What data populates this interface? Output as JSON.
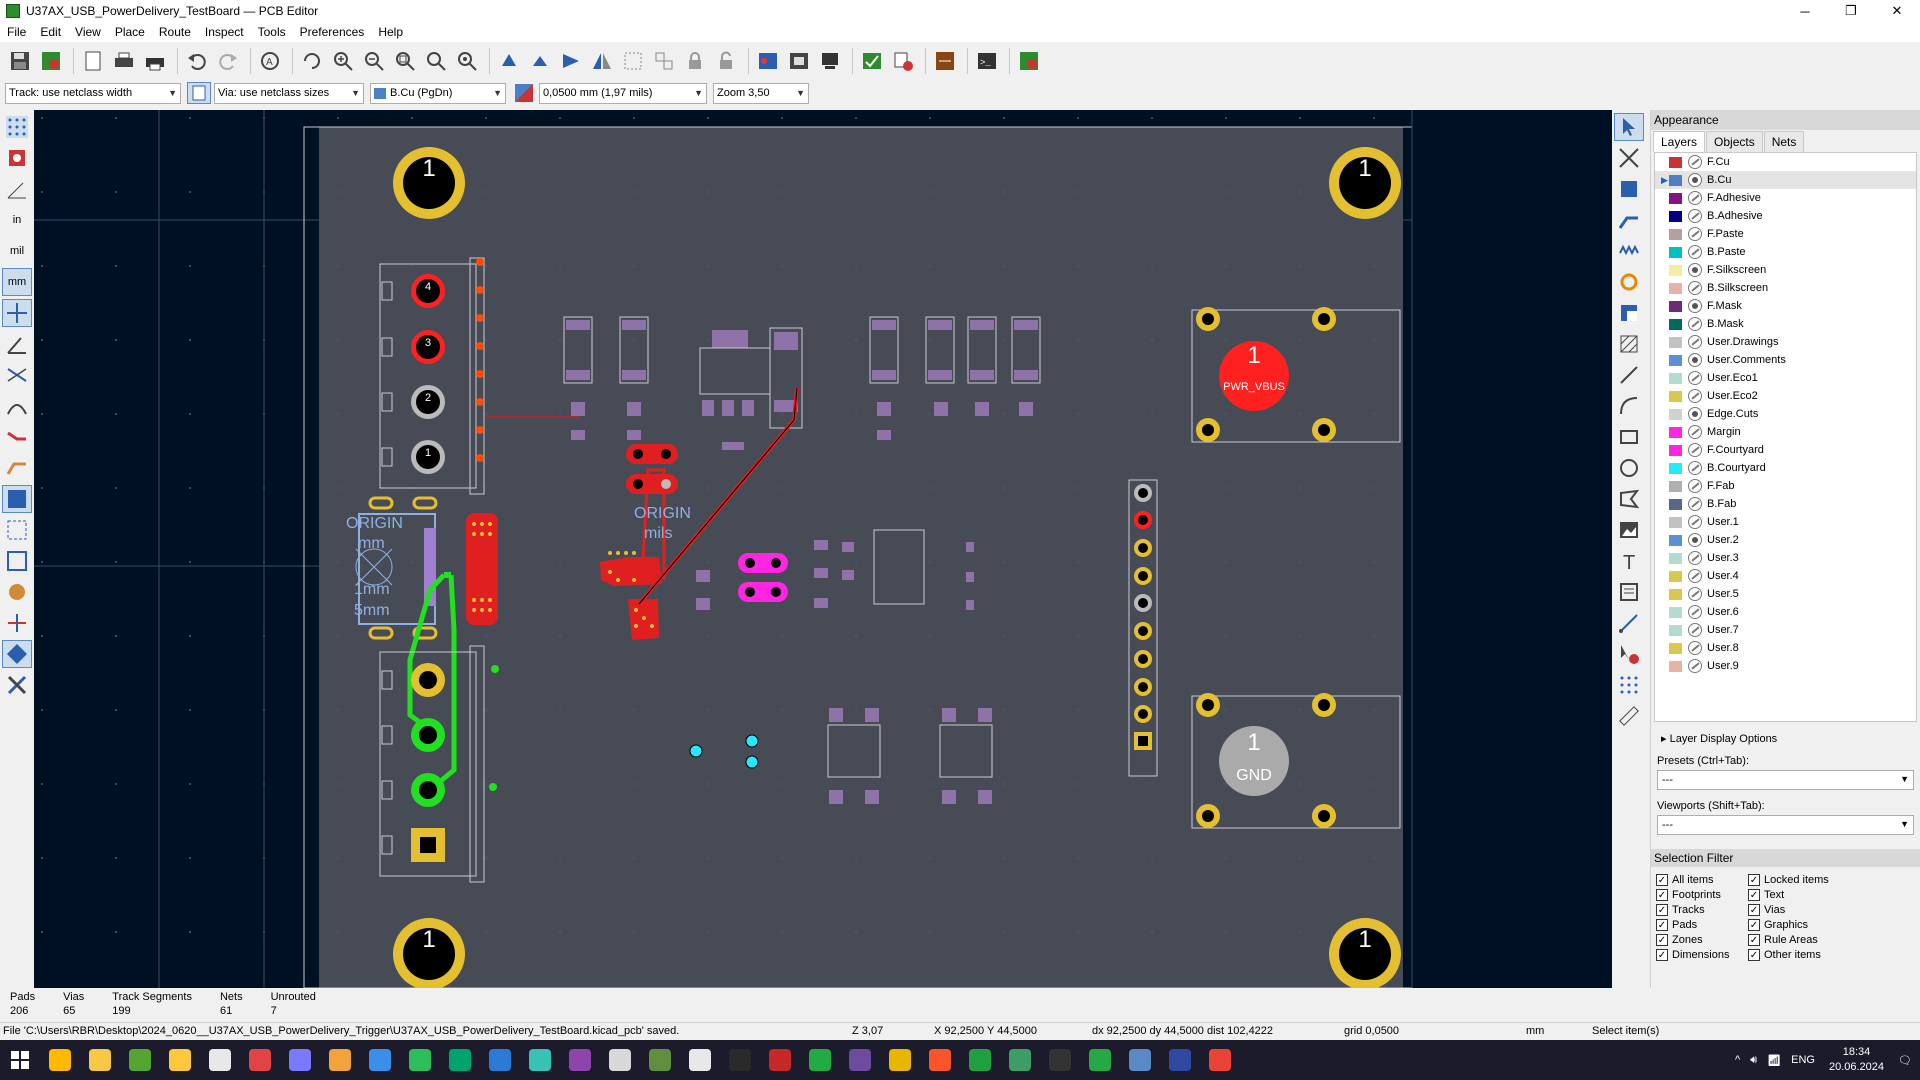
{
  "window": {
    "title": "U37AX_USB_PowerDelivery_TestBoard — PCB Editor",
    "minimize": "─",
    "maximize": "❐",
    "close": "✕"
  },
  "menu": [
    "File",
    "Edit",
    "View",
    "Place",
    "Route",
    "Inspect",
    "Tools",
    "Preferences",
    "Help"
  ],
  "toolbar2": {
    "track": "Track: use netclass width",
    "via": "Via: use netclass sizes",
    "layer": "B.Cu (PgDn)",
    "grid": "0,0500 mm (1,97 mils)",
    "zoom": "Zoom 3,50"
  },
  "left_toolbar": {
    "inch_label": "in",
    "mil_label": "mil",
    "mm_label": "mm"
  },
  "canvas": {
    "origin_mm": [
      "ORIGIN",
      "mm",
      "1mm",
      "5mm"
    ],
    "origin_mils": [
      "ORIGIN",
      "mils"
    ],
    "pwr_label": "PWR_VBUS",
    "gnd_label": "GND",
    "pad_number": "1",
    "gnd_small": "GND",
    "pins_left": [
      "4",
      "3",
      "2",
      "1"
    ]
  },
  "panel": {
    "title": "Appearance",
    "tabs": [
      "Layers",
      "Objects",
      "Nets"
    ],
    "layers": [
      {
        "name": "F.Cu",
        "color": "#c83434",
        "eye": "off"
      },
      {
        "name": "B.Cu",
        "color": "#4d7fc4",
        "eye": "on",
        "active": true
      },
      {
        "name": "F.Adhesive",
        "color": "#841384",
        "eye": "off"
      },
      {
        "name": "B.Adhesive",
        "color": "#000084",
        "eye": "off"
      },
      {
        "name": "F.Paste",
        "color": "#b4a0a0",
        "eye": "off"
      },
      {
        "name": "B.Paste",
        "color": "#00c2c2",
        "eye": "off"
      },
      {
        "name": "F.Silkscreen",
        "color": "#f2eda1",
        "eye": "on"
      },
      {
        "name": "B.Silkscreen",
        "color": "#e8b2a7",
        "eye": "off"
      },
      {
        "name": "F.Mask",
        "color": "#6e2a77",
        "eye": "on"
      },
      {
        "name": "B.Mask",
        "color": "#026a5a",
        "eye": "off"
      },
      {
        "name": "User.Drawings",
        "color": "#c2c2c2",
        "eye": "off"
      },
      {
        "name": "User.Comments",
        "color": "#5990d6",
        "eye": "on"
      },
      {
        "name": "User.Eco1",
        "color": "#b4dbd2",
        "eye": "off"
      },
      {
        "name": "User.Eco2",
        "color": "#d8c852",
        "eye": "off"
      },
      {
        "name": "Edge.Cuts",
        "color": "#d0d2cd",
        "eye": "on"
      },
      {
        "name": "Margin",
        "color": "#ff26e2",
        "eye": "off"
      },
      {
        "name": "F.Courtyard",
        "color": "#ff26e2",
        "eye": "off"
      },
      {
        "name": "B.Courtyard",
        "color": "#26e9ff",
        "eye": "off"
      },
      {
        "name": "F.Fab",
        "color": "#afafaf",
        "eye": "off"
      },
      {
        "name": "B.Fab",
        "color": "#58658c",
        "eye": "off"
      },
      {
        "name": "User.1",
        "color": "#c2c2c2",
        "eye": "off"
      },
      {
        "name": "User.2",
        "color": "#5990d6",
        "eye": "on"
      },
      {
        "name": "User.3",
        "color": "#b4dbd2",
        "eye": "off"
      },
      {
        "name": "User.4",
        "color": "#d8c852",
        "eye": "off"
      },
      {
        "name": "User.5",
        "color": "#d8c852",
        "eye": "off"
      },
      {
        "name": "User.6",
        "color": "#b4dbd2",
        "eye": "off"
      },
      {
        "name": "User.7",
        "color": "#b4dbd2",
        "eye": "off"
      },
      {
        "name": "User.8",
        "color": "#d8c852",
        "eye": "off"
      },
      {
        "name": "User.9",
        "color": "#e8b2a7",
        "eye": "off"
      }
    ],
    "layer_display_options": "Layer Display Options",
    "presets_label": "Presets (Ctrl+Tab):",
    "presets_value": "---",
    "viewports_label": "Viewports (Shift+Tab):",
    "viewports_value": "---",
    "selection_filter": "Selection Filter",
    "filters_left": [
      "All items",
      "Footprints",
      "Tracks",
      "Pads",
      "Zones",
      "Dimensions"
    ],
    "filters_right": [
      "Locked items",
      "Text",
      "Vias",
      "Graphics",
      "Rule Areas",
      "Other items"
    ]
  },
  "status": [
    {
      "label": "Pads",
      "value": "206"
    },
    {
      "label": "Vias",
      "value": "65"
    },
    {
      "label": "Track Segments",
      "value": "199"
    },
    {
      "label": "Nets",
      "value": "61"
    },
    {
      "label": "Unrouted",
      "value": "7"
    }
  ],
  "message": {
    "file": "File 'C:\\Users\\RBR\\Desktop\\2024_0620__U37AX_USB_PowerDelivery_Trigger\\U37AX_USB_PowerDelivery_TestBoard.kicad_pcb' saved.",
    "zoom": "Z 3,07",
    "xy": "X 92,2500  Y 44,5000",
    "dxy": "dx 92,2500  dy 44,5000  dist 102,4222",
    "grid": "grid 0,0500",
    "units": "mm",
    "mode": "Select item(s)"
  },
  "taskbar": {
    "lang": "ENG",
    "time": "18:34",
    "date": "20.06.2024",
    "apps": [
      "#ffb900",
      "#f7c843",
      "#55a630",
      "#ffc83d",
      "#e8e8e8",
      "#e04444",
      "#7a7aff",
      "#f2a33a",
      "#3b8eea",
      "#2dbd5a",
      "#00a36c",
      "#2b7bd6",
      "#37c2b3",
      "#8e44ad",
      "#d8d8d8",
      "#5f8f3f",
      "#e8e8e8",
      "#2a2a2a",
      "#c62828",
      "#22aa44",
      "#6d4c9f",
      "#e8b500",
      "#fb542b",
      "#20a040",
      "#3c9e64",
      "#333333",
      "#28a745",
      "#5a8ac6",
      "#3148a0",
      "#ea4335"
    ]
  }
}
